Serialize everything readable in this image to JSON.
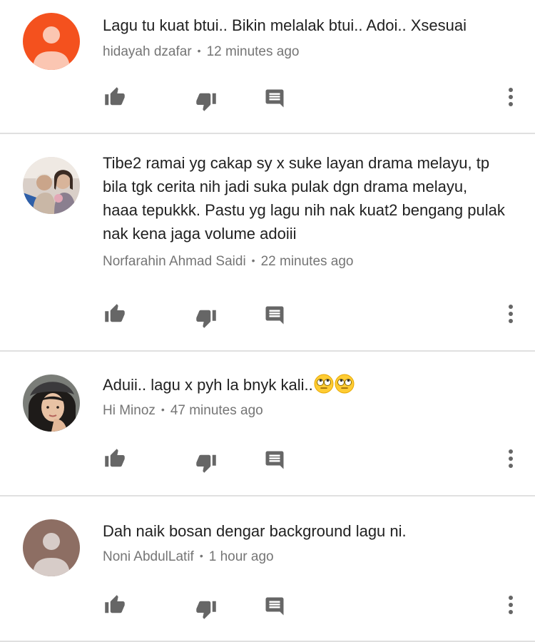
{
  "comments": [
    {
      "text": "Lagu tu kuat btui.. Bikin melalak btui.. Adoi.. Xsesuai",
      "author": "hidayah dzafar",
      "time": "12 minutes ago",
      "avatar": "default-avatar",
      "avatar_color": "#f4511e"
    },
    {
      "text": "Tibe2 ramai yg cakap sy x suke layan drama melayu, tp bila tgk cerita nih jadi suka pulak dgn drama melayu, haaa tepukkk. Pastu yg lagu nih nak kuat2 bengang pulak nak kena jaga volume adoiii",
      "author": "Norfarahin Ahmad Saidi",
      "time": "22 minutes ago",
      "avatar": "photo-avatar"
    },
    {
      "text": "Aduii.. lagu x pyh la bnyk kali..",
      "emoji": [
        "rolling-eyes-emoji",
        "rolling-eyes-emoji"
      ],
      "author": "Hi Minoz",
      "time": "47 minutes ago",
      "avatar": "photo-avatar"
    },
    {
      "text": "Dah naik bosan dengar background lagu ni.",
      "author": "Noni AbdulLatif",
      "time": "1 hour ago",
      "avatar": "default-avatar",
      "avatar_color": "#8d6e63"
    }
  ],
  "action_icons": [
    "thumbs-up-icon",
    "thumbs-down-icon",
    "reply-icon",
    "more-vert-icon"
  ],
  "colors": {
    "icon": "#666666",
    "meta_text": "#757575",
    "divider": "#e0e0e0"
  }
}
